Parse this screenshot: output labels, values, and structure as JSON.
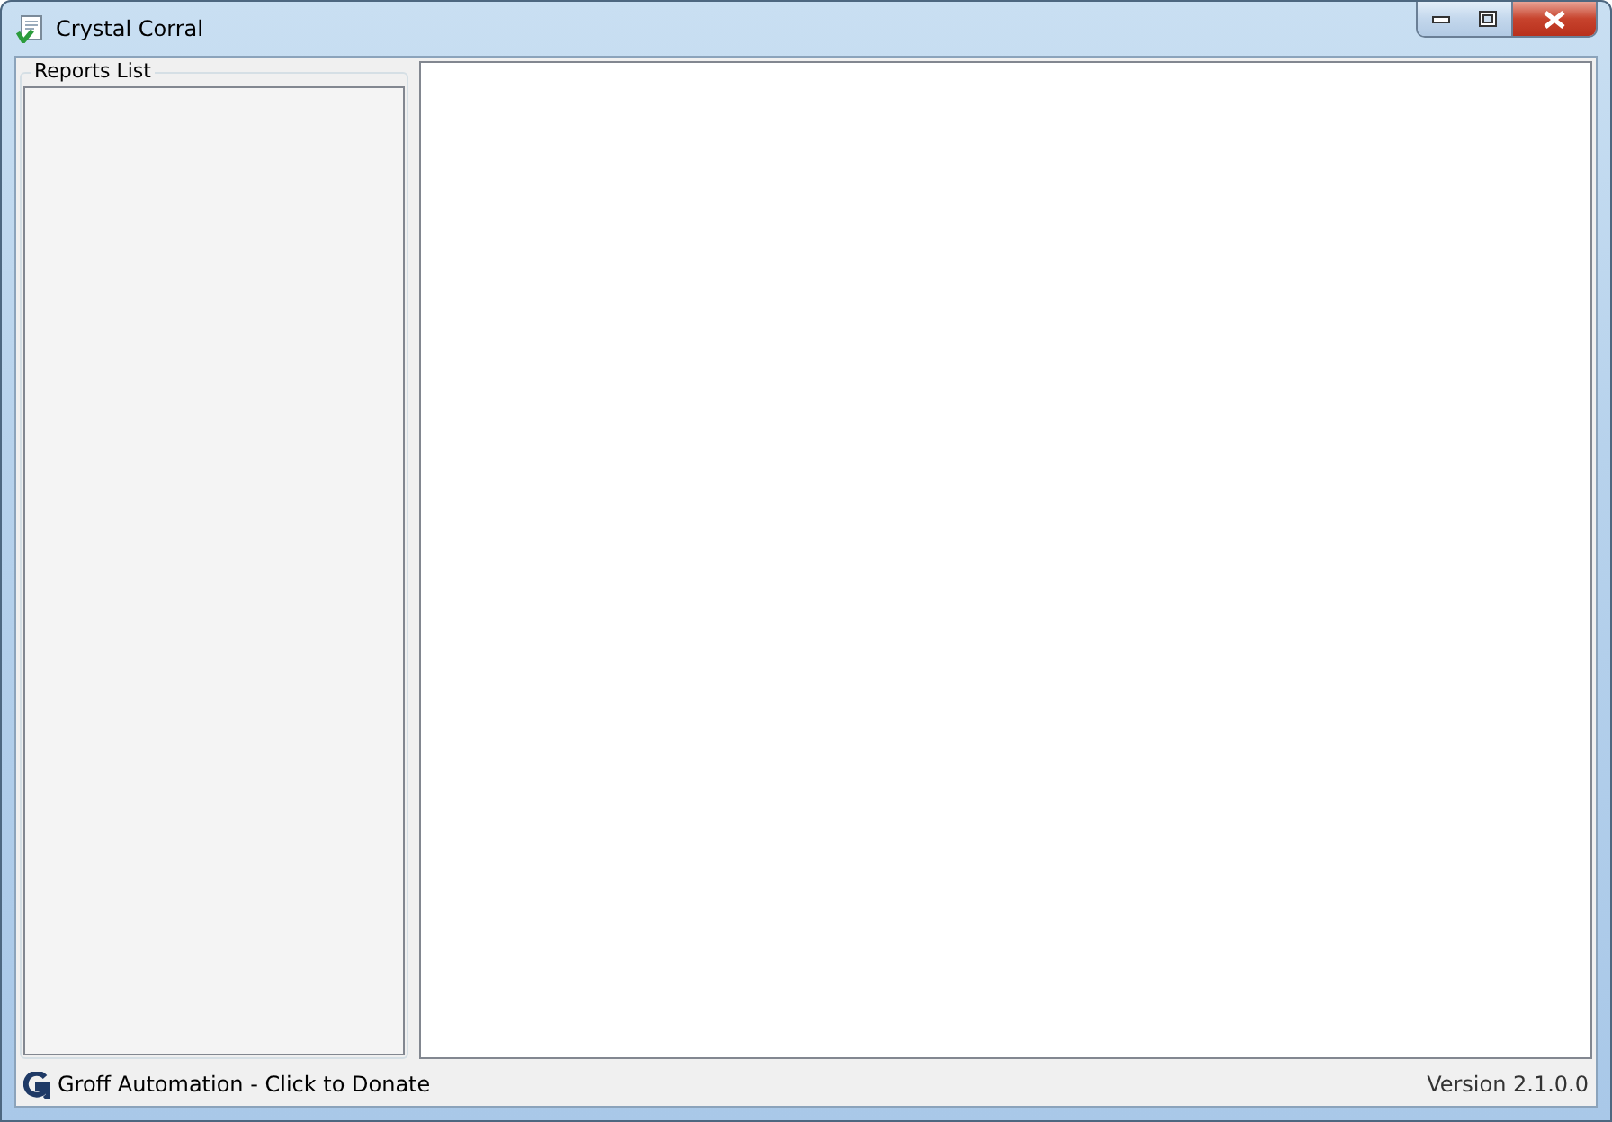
{
  "window": {
    "title": "Crystal Corral"
  },
  "reports_list": {
    "title": "Reports List"
  },
  "status_bar": {
    "link": "Groff Automation - Click to Donate",
    "version": "Version 2.1.0.0"
  }
}
